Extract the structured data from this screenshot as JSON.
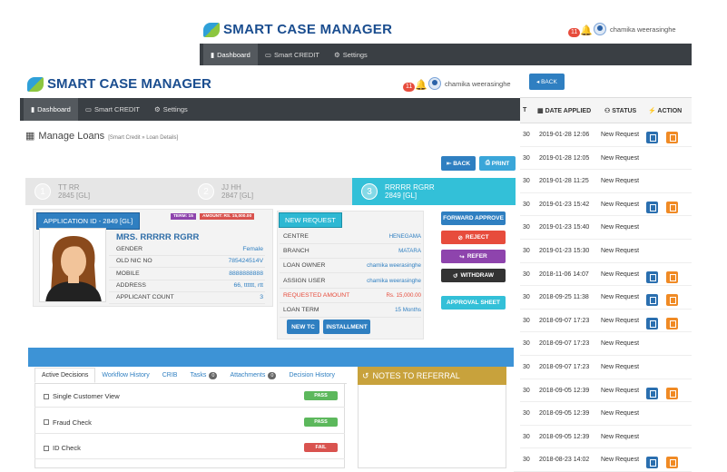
{
  "brand": {
    "name": "SMART CASE MANAGER"
  },
  "back_window": {
    "notif_count": "11",
    "user_name": "chamika weerasinghe",
    "nav": [
      "Dashboard",
      "Smart CREDIT",
      "Settings"
    ],
    "back_label": "BACK",
    "table": {
      "headers": {
        "date": "DATE APPLIED",
        "status": "STATUS",
        "action": "ACTION"
      },
      "rows": [
        {
          "left": "30",
          "date": "2019-01-28 12:06",
          "status": "New Request",
          "actions": true
        },
        {
          "left": "30",
          "date": "2019-01-28 12:05",
          "status": "New Request",
          "actions": false
        },
        {
          "left": "30",
          "date": "2019-01-28 11:25",
          "status": "New Request",
          "actions": false
        },
        {
          "left": "30",
          "date": "2019-01-23 15:42",
          "status": "New Request",
          "actions": true
        },
        {
          "left": "30",
          "date": "2019-01-23 15:40",
          "status": "New Request",
          "actions": false
        },
        {
          "left": "30",
          "date": "2019-01-23 15:30",
          "status": "New Request",
          "actions": false
        },
        {
          "left": "30",
          "date": "2018-11-06 14:07",
          "status": "New Request",
          "actions": true
        },
        {
          "left": "30",
          "date": "2018-09-25 11:38",
          "status": "New Request",
          "actions": true
        },
        {
          "left": "30",
          "date": "2018-09-07 17:23",
          "status": "New Request",
          "actions": true
        },
        {
          "left": "30",
          "date": "2018-09-07 17:23",
          "status": "New Request",
          "actions": false
        },
        {
          "left": "30",
          "date": "2018-09-07 17:23",
          "status": "New Request",
          "actions": false
        },
        {
          "left": "30",
          "date": "2018-09-05 12:39",
          "status": "New Request",
          "actions": true
        },
        {
          "left": "30",
          "date": "2018-09-05 12:39",
          "status": "New Request",
          "actions": false
        },
        {
          "left": "30",
          "date": "2018-09-05 12:39",
          "status": "New Request",
          "actions": false
        },
        {
          "left": "30",
          "date": "2018-08-23 14:02",
          "status": "New Request",
          "actions": true
        }
      ]
    }
  },
  "front_window": {
    "notif_count": "11",
    "user_name": "chamika weerasinghe",
    "nav": [
      "Dashboard",
      "Smart CREDIT",
      "Settings"
    ],
    "page_title": "Manage Loans",
    "breadcrumb": "[Smart Credit » Loan Details]",
    "back_label": "BACK",
    "print_label": "PRINT",
    "steps": [
      {
        "num": "1",
        "name": "TT RR",
        "amount": "2845 [GL]"
      },
      {
        "num": "2",
        "name": "JJ HH",
        "amount": "2847 [GL]"
      },
      {
        "num": "3",
        "name": "RRRRR RGRR",
        "amount": "2849 [GL]"
      }
    ],
    "application_id": "APPLICATION ID - 2849 [GL]",
    "term_tag": "TERM: 15",
    "amount_tag": "AMOUNT: RS. 15,000.00",
    "customer": {
      "name": "MRS. RRRRR RGRR",
      "fields": [
        {
          "label": "GENDER",
          "value": "Female"
        },
        {
          "label": "OLD NIC NO",
          "value": "785424514V"
        },
        {
          "label": "MOBILE",
          "value": "8888888888"
        },
        {
          "label": "ADDRESS",
          "value": "66, tttttt, rtt"
        },
        {
          "label": "APPLICANT COUNT",
          "value": "3"
        }
      ]
    },
    "request": {
      "badge": "NEW REQUEST",
      "fields": [
        {
          "label": "CENTRE",
          "value": "HENEGAMA"
        },
        {
          "label": "BRANCH",
          "value": "MATARA"
        },
        {
          "label": "LOAN OWNER",
          "value": "chamika weerasinghe"
        },
        {
          "label": "ASSIGN USER",
          "value": "chamika weerasinghe"
        },
        {
          "label": "REQUESTED AMOUNT",
          "value": "Rs. 15,000.00"
        },
        {
          "label": "LOAN TERM",
          "value": "15 Months"
        }
      ],
      "new_tc": "NEW TC",
      "installment": "INSTALLMENT"
    },
    "actions": {
      "forward": "FORWARD APPROVE",
      "reject": "REJECT",
      "refer": "REFER",
      "withdraw": "WITHDRAW",
      "approval_sheet": "APPROVAL SHEET"
    },
    "tabs": [
      {
        "label": "Active Decisions",
        "count": ""
      },
      {
        "label": "Workflow History",
        "count": ""
      },
      {
        "label": "CRIB",
        "count": ""
      },
      {
        "label": "Tasks",
        "count": "0"
      },
      {
        "label": "Attachments",
        "count": "0"
      },
      {
        "label": "Decision History",
        "count": ""
      }
    ],
    "decisions": [
      {
        "label": "Single Customer View",
        "status": "PASS"
      },
      {
        "label": "Fraud Check",
        "status": "PASS"
      },
      {
        "label": "ID Check",
        "status": "FAIL"
      }
    ],
    "referral_title": "NOTES TO REFERRAL"
  },
  "colors": {
    "primary": "#2f7fc1",
    "nav": "#3a3f44",
    "step_active": "#33c0d8",
    "pass": "#5cb85c",
    "fail": "#d9534f",
    "refer": "#8e44ad",
    "referral": "#c8a23c"
  }
}
